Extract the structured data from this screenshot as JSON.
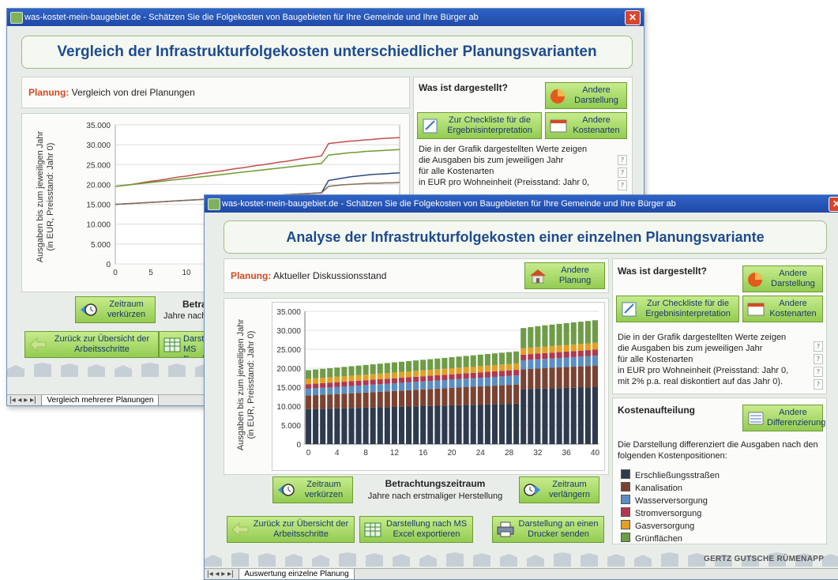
{
  "back_window": {
    "title": "was-kostet-mein-baugebiet.de - Schätzen Sie die Folgekosten von Baugebieten für Ihre Gemeinde und Ihre Bürger ab",
    "heading": "Vergleich der Infrastrukturfolgekosten unterschiedlicher Planungsvarianten",
    "planung_label": "Planung:",
    "planung_value": "Vergleich von drei Planungen",
    "was_ist_dargestellt": "Was ist dargestellt?",
    "andere_darstellung": "Andere Darstellung",
    "checkliste": "Zur Checkliste für die Ergebnisinterpretation",
    "andere_kostenarten": "Andere Kostenarten",
    "desc_lines": [
      "Die in der Grafik dargestellten Werte zeigen",
      "die Ausgaben bis zum jeweiligen Jahr",
      "für alle Kostenarten",
      "in EUR pro Wohneinheit (Preisstand: Jahr 0,"
    ],
    "ylabel_lines": [
      "Ausgaben bis zum jeweiligen Jahr",
      "(in EUR, Preisstand: Jahr 0)"
    ],
    "yticks": [
      "35.000",
      "30.000",
      "25.000",
      "20.000",
      "15.000",
      "10.000",
      "5.000",
      "0"
    ],
    "xticks": [
      "0",
      "5",
      "10"
    ],
    "zeitraum_verkuerzen": "Zeitraum verkürzen",
    "betrachtung_partial": "Betra",
    "jahre_partial": "Jahre nach",
    "zurueck": "Zurück zur Übersicht der Arbeitsschritte",
    "excel_partial": "Darste MS Excel",
    "tab": "Vergleich mehrerer Planungen"
  },
  "front_window": {
    "title": "was-kostet-mein-baugebiet.de - Schätzen Sie die Folgekosten von Baugebieten für Ihre Gemeinde und Ihre Bürger ab",
    "heading": "Analyse der Infrastrukturfolgekosten einer einzelnen Planungsvariante",
    "planung_label": "Planung:",
    "planung_value": "Aktueller Diskussionsstand",
    "andere_planung": "Andere Planung",
    "was_ist_dargestellt": "Was ist dargestellt?",
    "andere_darstellung": "Andere Darstellung",
    "checkliste": "Zur Checkliste für die Ergebnisinterpretation",
    "andere_kostenarten": "Andere Kostenarten",
    "desc_lines": [
      "Die in der Grafik dargestellten Werte zeigen",
      "die Ausgaben bis zum jeweiligen Jahr",
      "für alle Kostenarten",
      "in EUR pro Wohneinheit (Preisstand: Jahr 0,",
      "mit 2% p.a. real diskontiert auf das Jahr 0)."
    ],
    "kostenaufteilung": "Kostenaufteilung",
    "andere_differenzierung": "Andere Differenzierung",
    "kosten_desc": "Die Darstellung differenziert die Ausgaben nach den folgenden Kostenpositionen:",
    "legend": [
      {
        "label": "Erschließungsstraßen",
        "color": "#2e3b4e"
      },
      {
        "label": "Kanalisation",
        "color": "#7a4331"
      },
      {
        "label": "Wasserversorgung",
        "color": "#5b8ec2"
      },
      {
        "label": "Stromversorgung",
        "color": "#b0384f"
      },
      {
        "label": "Gasversorgung",
        "color": "#e0a126"
      },
      {
        "label": "Grünflächen",
        "color": "#6f9c48"
      }
    ],
    "ylabel_lines": [
      "Ausgaben bis zum jeweiligen Jahr",
      "(in EUR, Preisstand: Jahr 0)"
    ],
    "zeitraum_verkuerzen": "Zeitraum verkürzen",
    "betrachtungszeitraum": "Betrachtungszeitraum",
    "jahre_nach": "Jahre nach erstmaliger Herstellung",
    "zeitraum_verlaengern": "Zeitraum verlängern",
    "zurueck": "Zurück zur Übersicht der Arbeitsschritte",
    "excel": "Darstellung nach MS Excel exportieren",
    "drucker": "Darstellung an einen Drucker senden",
    "brand": "GERTZ GUTSCHE RÜMENAPP",
    "tab": "Auswertung einzelne Planung"
  },
  "chart_data": [
    {
      "type": "line",
      "xlabel": "",
      "ylabel": "Ausgaben bis zum jeweiligen Jahr (in EUR, Preisstand: Jahr 0)",
      "ylim": [
        0,
        35000
      ],
      "x": [
        0,
        1,
        2,
        3,
        4,
        5,
        6,
        7,
        8,
        9,
        10,
        11,
        12,
        13,
        14,
        15,
        16,
        17,
        18,
        19,
        20,
        21,
        22,
        23,
        24,
        25,
        26,
        27,
        28,
        29,
        30,
        31,
        32,
        33,
        34,
        35,
        36,
        37,
        38,
        39,
        40
      ],
      "series": [
        {
          "color": "#c0504d",
          "values": [
            19500,
            19700,
            19900,
            20200,
            20500,
            20800,
            21000,
            21300,
            21600,
            21900,
            22100,
            22400,
            22700,
            22900,
            23200,
            23400,
            23700,
            24000,
            24200,
            24500,
            24800,
            25000,
            25300,
            25600,
            25800,
            26100,
            26400,
            26700,
            26900,
            27200,
            30300,
            30500,
            30700,
            30900,
            31000,
            31200,
            31300,
            31500,
            31600,
            31700,
            31800
          ]
        },
        {
          "color": "#6e9a2f",
          "values": [
            19500,
            19700,
            19900,
            20100,
            20300,
            20500,
            20700,
            20900,
            21100,
            21300,
            21500,
            21700,
            21900,
            22100,
            22300,
            22500,
            22700,
            22900,
            23100,
            23300,
            23500,
            23700,
            23900,
            24100,
            24300,
            24500,
            24700,
            24900,
            25100,
            25300,
            27400,
            27600,
            27800,
            28000,
            28100,
            28300,
            28400,
            28500,
            28600,
            28700,
            28800
          ]
        },
        {
          "color": "#2d4a7a",
          "values": [
            15000,
            15100,
            15200,
            15300,
            15400,
            15500,
            15600,
            15700,
            15800,
            15900,
            16000,
            16100,
            16200,
            16300,
            16400,
            16500,
            16600,
            16700,
            16800,
            16900,
            17000,
            17100,
            17200,
            17300,
            17400,
            17500,
            17600,
            17700,
            17800,
            17900,
            21000,
            21300,
            21600,
            21900,
            22100,
            22300,
            22500,
            22600,
            22700,
            22800,
            22900
          ]
        },
        {
          "color": "#8a6d5a",
          "values": [
            15000,
            15100,
            15200,
            15300,
            15400,
            15500,
            15600,
            15700,
            15800,
            15900,
            16000,
            16100,
            16200,
            16300,
            16400,
            16500,
            16600,
            16700,
            16800,
            16900,
            17000,
            17100,
            17200,
            17300,
            17400,
            17500,
            17600,
            17700,
            17800,
            17900,
            19500,
            19700,
            19900,
            20000,
            20100,
            20200,
            20300,
            20300,
            20400,
            20400,
            20500
          ]
        }
      ]
    },
    {
      "type": "bar",
      "stacked": true,
      "ylim": [
        0,
        35000
      ],
      "yticks": [
        0,
        5000,
        10000,
        15000,
        20000,
        25000,
        30000,
        35000
      ],
      "xticks": [
        0,
        4,
        8,
        12,
        16,
        20,
        24,
        28,
        32,
        36,
        40
      ],
      "ylabel": "Ausgaben bis zum jeweiligen Jahr (in EUR, Preisstand: Jahr 0)",
      "x": [
        0,
        1,
        2,
        3,
        4,
        5,
        6,
        7,
        8,
        9,
        10,
        11,
        12,
        13,
        14,
        15,
        16,
        17,
        18,
        19,
        20,
        21,
        22,
        23,
        24,
        25,
        26,
        27,
        28,
        29,
        30,
        31,
        32,
        33,
        34,
        35,
        36,
        37,
        38,
        39,
        40
      ],
      "series": [
        {
          "name": "Erschließungsstraßen",
          "color": "#2e3b4e",
          "values": [
            9200,
            9250,
            9300,
            9350,
            9400,
            9450,
            9500,
            9550,
            9600,
            9650,
            9700,
            9750,
            9800,
            9850,
            9900,
            9950,
            10000,
            10050,
            10100,
            10150,
            10200,
            10250,
            10300,
            10350,
            10400,
            10450,
            10500,
            10550,
            10600,
            10650,
            14500,
            14550,
            14600,
            14650,
            14700,
            14750,
            14800,
            14850,
            14900,
            14950,
            15000
          ]
        },
        {
          "name": "Kanalisation",
          "color": "#7a4331",
          "values": [
            3600,
            3650,
            3700,
            3750,
            3800,
            3850,
            3900,
            3950,
            4000,
            4050,
            4100,
            4150,
            4200,
            4250,
            4300,
            4350,
            4400,
            4450,
            4500,
            4550,
            4600,
            4650,
            4700,
            4750,
            4800,
            4850,
            4900,
            4950,
            5000,
            5050,
            5200,
            5250,
            5300,
            5350,
            5400,
            5450,
            5500,
            5550,
            5600,
            5650,
            5700
          ]
        },
        {
          "name": "Wasserversorgung",
          "color": "#5b8ec2",
          "values": [
            1800,
            1820,
            1840,
            1860,
            1880,
            1900,
            1920,
            1940,
            1960,
            1980,
            2000,
            2020,
            2040,
            2060,
            2080,
            2100,
            2120,
            2140,
            2160,
            2180,
            2200,
            2220,
            2240,
            2260,
            2280,
            2300,
            2320,
            2340,
            2360,
            2380,
            2400,
            2420,
            2440,
            2460,
            2480,
            2500,
            2520,
            2540,
            2560,
            2580,
            2600
          ]
        },
        {
          "name": "Stromversorgung",
          "color": "#b0384f",
          "values": [
            1200,
            1210,
            1220,
            1230,
            1240,
            1250,
            1260,
            1270,
            1280,
            1290,
            1300,
            1310,
            1320,
            1330,
            1340,
            1350,
            1360,
            1370,
            1380,
            1390,
            1400,
            1410,
            1420,
            1430,
            1440,
            1450,
            1460,
            1470,
            1480,
            1490,
            1500,
            1510,
            1520,
            1530,
            1540,
            1550,
            1560,
            1570,
            1580,
            1590,
            1600
          ]
        },
        {
          "name": "Gasversorgung",
          "color": "#e0a126",
          "values": [
            1400,
            1410,
            1420,
            1430,
            1440,
            1450,
            1460,
            1470,
            1480,
            1490,
            1500,
            1510,
            1520,
            1530,
            1540,
            1550,
            1560,
            1570,
            1580,
            1590,
            1600,
            1610,
            1620,
            1630,
            1640,
            1650,
            1660,
            1670,
            1680,
            1690,
            1700,
            1710,
            1720,
            1730,
            1740,
            1750,
            1760,
            1770,
            1780,
            1790,
            1800
          ]
        },
        {
          "name": "Grünflächen",
          "color": "#6f9c48",
          "values": [
            2300,
            2330,
            2360,
            2390,
            2420,
            2450,
            2480,
            2510,
            2540,
            2570,
            2600,
            2630,
            2660,
            2690,
            2720,
            2750,
            2780,
            2810,
            2840,
            2870,
            2900,
            2930,
            2960,
            2990,
            3020,
            3050,
            3080,
            3110,
            3140,
            3170,
            5300,
            5400,
            5500,
            5600,
            5650,
            5700,
            5750,
            5800,
            5850,
            5900,
            5950
          ]
        }
      ]
    }
  ]
}
